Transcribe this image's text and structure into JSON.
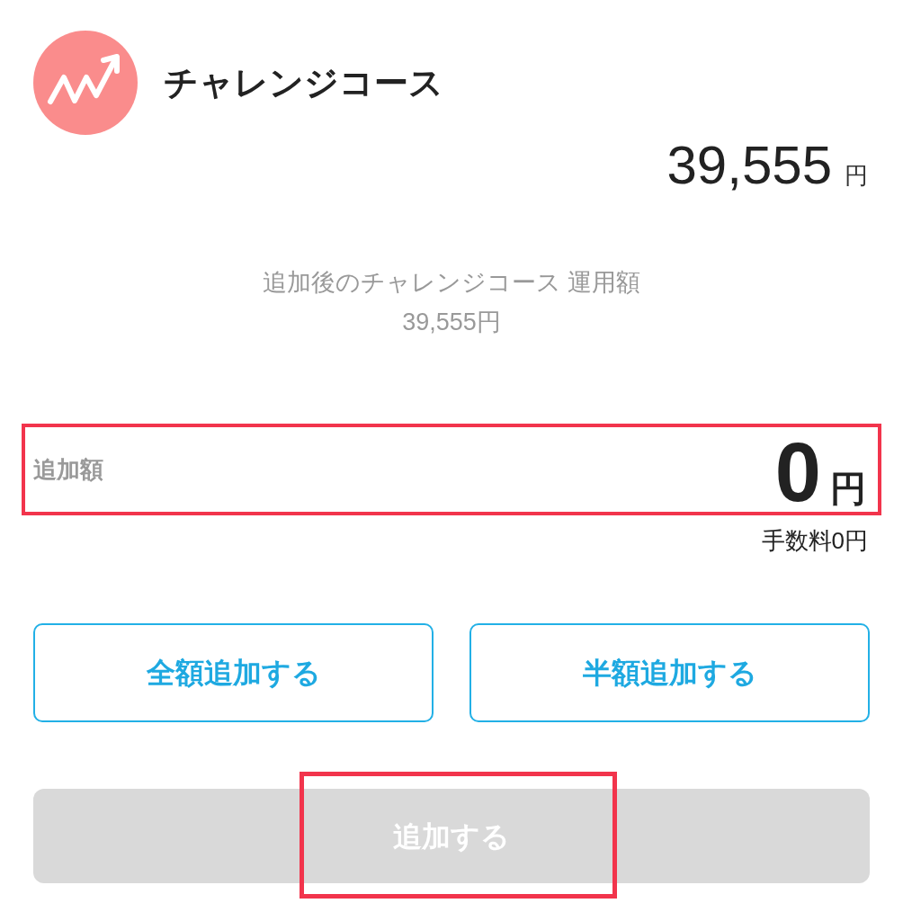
{
  "header": {
    "title": "チャレンジコース"
  },
  "balance": {
    "amount": "39,555",
    "unit": "円"
  },
  "after_add": {
    "label": "追加後のチャレンジコース 運用額",
    "amount": "39,555円"
  },
  "amount_field": {
    "label": "追加額",
    "value": "0",
    "unit": "円",
    "highlighted": true
  },
  "fee": "手数料0円",
  "quick_buttons": [
    {
      "label": "全額追加する"
    },
    {
      "label": "半額追加する"
    }
  ],
  "submit_button": {
    "label": "追加する",
    "disabled": true,
    "highlighted": true
  }
}
